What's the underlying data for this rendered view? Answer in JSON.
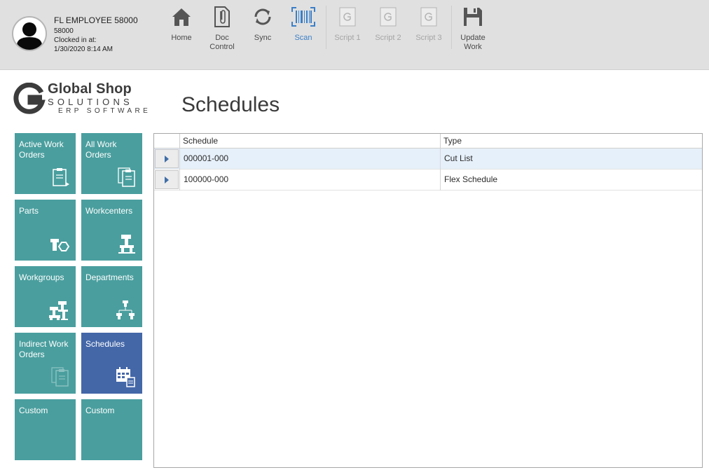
{
  "user": {
    "name": "FL EMPLOYEE 58000",
    "id": "58000",
    "clocked_label": "Clocked in at:",
    "clocked_time": "1/30/2020 8:14 AM"
  },
  "toolbar": {
    "home": "Home",
    "doc_control": "Doc\nControl",
    "sync": "Sync",
    "scan": "Scan",
    "script1": "Script 1",
    "script2": "Script 2",
    "script3": "Script 3",
    "update_work": "Update\nWork"
  },
  "logo": {
    "main": "Global Shop",
    "sub1": "SOLUTIONS",
    "sub2": "ERP SOFTWARE"
  },
  "page_title": "Schedules",
  "tiles": {
    "active_work_orders": "Active Work Orders",
    "all_work_orders": "All Work Orders",
    "parts": "Parts",
    "workcenters": "Workcenters",
    "workgroups": "Workgroups",
    "departments": "Departments",
    "indirect_work_orders": "Indirect Work Orders",
    "schedules": "Schedules",
    "custom1": "Custom",
    "custom2": "Custom"
  },
  "grid": {
    "columns": [
      "Schedule",
      "Type"
    ],
    "rows": [
      {
        "schedule": "000001-000",
        "type": "Cut List"
      },
      {
        "schedule": "100000-000",
        "type": "Flex Schedule"
      }
    ]
  },
  "colors": {
    "tile": "#4a9e9e",
    "tile_selected": "#4467a8",
    "accent": "#3b7fc7",
    "toolbar_bg": "#e0e0e0"
  }
}
